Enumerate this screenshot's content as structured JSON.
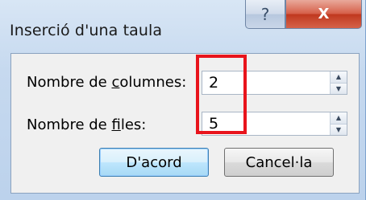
{
  "dialog": {
    "title": "Inserció d'una taula",
    "help_glyph": "?",
    "close_glyph": "X"
  },
  "fields": {
    "columns_label_pre": "Nombre de ",
    "columns_label_key": "c",
    "columns_label_post": "olumnes:",
    "columns_value": "2",
    "rows_label_pre": "Nombre de ",
    "rows_label_key": "f",
    "rows_label_post": "iles:",
    "rows_value": "5"
  },
  "buttons": {
    "ok_label": "D'acord",
    "cancel_label": "Cancel·la"
  },
  "icons": {
    "spin_up": "▲",
    "spin_down": "▼"
  },
  "colors": {
    "highlight": "#e8141c",
    "close_button": "#c7432b"
  }
}
